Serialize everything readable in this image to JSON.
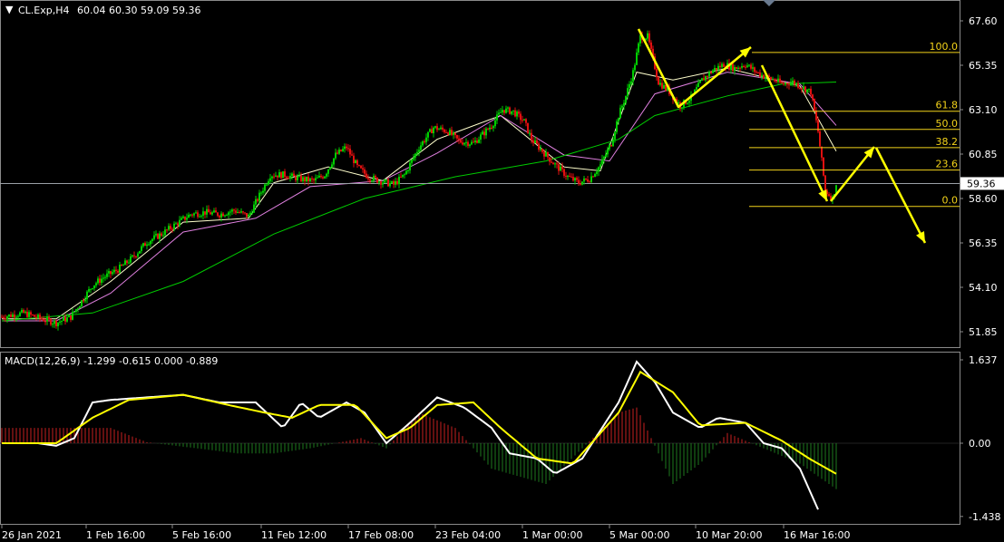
{
  "header": {
    "arrow": "▼",
    "symbol": "CL.Exp,H4",
    "ohlc": "60.04 60.30 59.09 59.36"
  },
  "price_axis": {
    "labels": [
      "67.60",
      "65.35",
      "63.10",
      "60.85",
      "58.60",
      "56.35",
      "54.10",
      "51.85"
    ],
    "current_price": "59.36"
  },
  "macd_header": {
    "label": "MACD(12,26,9) -1.299 -0.615 0.000 -0.889"
  },
  "macd_axis": {
    "labels": [
      "1.637",
      "0.00",
      "-1.438"
    ]
  },
  "time_axis": {
    "labels": [
      "26 Jan 2021",
      "1 Feb 16:00",
      "5 Feb 16:00",
      "11 Feb 12:00",
      "17 Feb 08:00",
      "23 Feb 04:00",
      "1 Mar 00:00",
      "5 Mar 00:00",
      "10 Mar 20:00",
      "16 Mar 16:00"
    ]
  },
  "fibonacci": {
    "levels": [
      "100.0",
      "61.8",
      "50.0",
      "38.2",
      "23.6",
      "0.0"
    ],
    "high": 66.0,
    "low": 58.2
  },
  "colors": {
    "background": "#000000",
    "bull": "#00cc00",
    "bear": "#e01010",
    "ma_fast": "#ffffcc",
    "ma_mid": "#e080e0",
    "ma_slow": "#00cc00",
    "fib": "#f2d21a",
    "arrow": "#ffff00",
    "macd_line": "#ffffff",
    "signal_line": "#ffff00",
    "hist_pos": "#c82020",
    "hist_neg": "#1e7a1e"
  },
  "chart_data": [
    {
      "type": "candlestick",
      "title": "CL.Exp,H4",
      "ylim": [
        51.85,
        67.6
      ],
      "x_ticks": [
        "26 Jan 2021",
        "1 Feb 16:00",
        "5 Feb 16:00",
        "11 Feb 12:00",
        "17 Feb 08:00",
        "23 Feb 04:00",
        "1 Mar 00:00",
        "5 Mar 00:00",
        "10 Mar 20:00",
        "16 Mar 16:00"
      ],
      "close_path": [
        [
          0,
          52.6
        ],
        [
          12,
          52.8
        ],
        [
          22,
          52.5
        ],
        [
          30,
          52.3
        ],
        [
          38,
          52.6
        ],
        [
          44,
          53.4
        ],
        [
          50,
          54.2
        ],
        [
          56,
          54.6
        ],
        [
          64,
          55.0
        ],
        [
          72,
          55.6
        ],
        [
          80,
          56.4
        ],
        [
          88,
          56.8
        ],
        [
          96,
          57.3
        ],
        [
          104,
          57.8
        ],
        [
          112,
          57.9
        ],
        [
          120,
          57.8
        ],
        [
          128,
          58.0
        ],
        [
          136,
          57.7
        ],
        [
          140,
          58.4
        ],
        [
          148,
          59.8
        ],
        [
          156,
          59.8
        ],
        [
          164,
          59.6
        ],
        [
          172,
          59.5
        ],
        [
          178,
          59.8
        ],
        [
          184,
          60.8
        ],
        [
          190,
          61.2
        ],
        [
          196,
          60.2
        ],
        [
          202,
          59.7
        ],
        [
          208,
          59.5
        ],
        [
          216,
          59.3
        ],
        [
          222,
          59.8
        ],
        [
          230,
          61.2
        ],
        [
          238,
          62.2
        ],
        [
          246,
          62.0
        ],
        [
          252,
          61.5
        ],
        [
          260,
          61.4
        ],
        [
          270,
          62.3
        ],
        [
          276,
          63.1
        ],
        [
          282,
          63.0
        ],
        [
          288,
          62.5
        ],
        [
          292,
          61.6
        ],
        [
          298,
          61.0
        ],
        [
          304,
          60.4
        ],
        [
          312,
          59.7
        ],
        [
          318,
          59.4
        ],
        [
          324,
          59.6
        ],
        [
          330,
          60.3
        ],
        [
          336,
          61.4
        ],
        [
          340,
          62.8
        ],
        [
          344,
          63.8
        ],
        [
          348,
          65.0
        ],
        [
          352,
          66.8
        ],
        [
          356,
          66.8
        ],
        [
          362,
          64.5
        ],
        [
          368,
          64.0
        ],
        [
          374,
          63.3
        ],
        [
          380,
          63.7
        ],
        [
          386,
          64.6
        ],
        [
          392,
          65.1
        ],
        [
          398,
          65.4
        ],
        [
          404,
          65.2
        ],
        [
          410,
          65.4
        ],
        [
          416,
          65.0
        ],
        [
          420,
          64.8
        ],
        [
          426,
          64.6
        ],
        [
          430,
          64.4
        ],
        [
          436,
          64.5
        ],
        [
          442,
          64.2
        ],
        [
          446,
          64.0
        ],
        [
          450,
          62.0
        ],
        [
          454,
          59.0
        ],
        [
          458,
          58.6
        ],
        [
          460,
          59.36
        ]
      ],
      "moving_averages": [
        {
          "name": "fast",
          "values": [
            [
              0,
              52.5
            ],
            [
              30,
              52.5
            ],
            [
              60,
              54.4
            ],
            [
              100,
              57.4
            ],
            [
              136,
              57.6
            ],
            [
              150,
              59.4
            ],
            [
              180,
              60.2
            ],
            [
              210,
              59.5
            ],
            [
              240,
              61.6
            ],
            [
              275,
              62.8
            ],
            [
              310,
              60.2
            ],
            [
              330,
              60.0
            ],
            [
              350,
              65.0
            ],
            [
              370,
              64.6
            ],
            [
              400,
              65.2
            ],
            [
              440,
              64.3
            ],
            [
              460,
              61.0
            ]
          ]
        },
        {
          "name": "mid",
          "values": [
            [
              0,
              52.4
            ],
            [
              30,
              52.4
            ],
            [
              60,
              53.8
            ],
            [
              100,
              56.9
            ],
            [
              140,
              57.6
            ],
            [
              170,
              59.2
            ],
            [
              210,
              59.5
            ],
            [
              240,
              60.9
            ],
            [
              275,
              62.8
            ],
            [
              310,
              60.8
            ],
            [
              335,
              60.5
            ],
            [
              360,
              63.9
            ],
            [
              400,
              65.0
            ],
            [
              440,
              64.4
            ],
            [
              460,
              62.3
            ]
          ]
        },
        {
          "name": "slow",
          "values": [
            [
              0,
              52.4
            ],
            [
              50,
              52.8
            ],
            [
              100,
              54.4
            ],
            [
              150,
              56.8
            ],
            [
              200,
              58.6
            ],
            [
              250,
              59.7
            ],
            [
              300,
              60.5
            ],
            [
              340,
              61.6
            ],
            [
              360,
              62.8
            ],
            [
              400,
              63.8
            ],
            [
              430,
              64.4
            ],
            [
              460,
              64.5
            ]
          ]
        }
      ],
      "fib_levels": {
        "100.0": 66.0,
        "61.8": 63.02,
        "50.0": 62.1,
        "38.2": 61.18,
        "23.6": 60.04,
        "0.0": 58.2
      },
      "current_price": 59.36
    },
    {
      "type": "line",
      "title": "MACD(12,26,9) -1.299 -0.615 0.000 -0.889",
      "ylim": [
        -1.438,
        1.637
      ],
      "series": [
        {
          "name": "MACD",
          "values": [
            [
              0,
              0.0
            ],
            [
              20,
              0.0
            ],
            [
              30,
              -0.05
            ],
            [
              40,
              0.1
            ],
            [
              50,
              0.8
            ],
            [
              60,
              0.85
            ],
            [
              80,
              0.9
            ],
            [
              100,
              0.95
            ],
            [
              120,
              0.8
            ],
            [
              140,
              0.8
            ],
            [
              155,
              0.3
            ],
            [
              165,
              0.8
            ],
            [
              175,
              0.5
            ],
            [
              190,
              0.8
            ],
            [
              200,
              0.6
            ],
            [
              212,
              0.0
            ],
            [
              225,
              0.4
            ],
            [
              240,
              0.9
            ],
            [
              255,
              0.7
            ],
            [
              270,
              0.3
            ],
            [
              280,
              -0.2
            ],
            [
              295,
              -0.3
            ],
            [
              305,
              -0.6
            ],
            [
              320,
              -0.3
            ],
            [
              340,
              0.8
            ],
            [
              350,
              1.6
            ],
            [
              360,
              1.2
            ],
            [
              370,
              0.6
            ],
            [
              385,
              0.3
            ],
            [
              395,
              0.5
            ],
            [
              410,
              0.4
            ],
            [
              420,
              0.0
            ],
            [
              430,
              -0.1
            ],
            [
              440,
              -0.5
            ],
            [
              450,
              -1.3
            ]
          ]
        },
        {
          "name": "Signal",
          "values": [
            [
              0,
              0.0
            ],
            [
              30,
              0.0
            ],
            [
              50,
              0.5
            ],
            [
              70,
              0.85
            ],
            [
              100,
              0.95
            ],
            [
              125,
              0.75
            ],
            [
              145,
              0.6
            ],
            [
              160,
              0.5
            ],
            [
              175,
              0.75
            ],
            [
              195,
              0.75
            ],
            [
              212,
              0.1
            ],
            [
              225,
              0.3
            ],
            [
              240,
              0.75
            ],
            [
              260,
              0.8
            ],
            [
              275,
              0.3
            ],
            [
              295,
              -0.3
            ],
            [
              315,
              -0.4
            ],
            [
              340,
              0.6
            ],
            [
              352,
              1.4
            ],
            [
              370,
              1.0
            ],
            [
              385,
              0.35
            ],
            [
              410,
              0.4
            ],
            [
              430,
              0.05
            ],
            [
              445,
              -0.3
            ],
            [
              460,
              -0.6
            ]
          ]
        },
        {
          "name": "Histogram",
          "values": [
            [
              50,
              0.3
            ],
            [
              60,
              0.3
            ],
            [
              80,
              0.02
            ],
            [
              130,
              -0.2
            ],
            [
              150,
              -0.2
            ],
            [
              170,
              -0.1
            ],
            [
              198,
              0.1
            ],
            [
              212,
              -0.1
            ],
            [
              230,
              0.6
            ],
            [
              250,
              0.3
            ],
            [
              270,
              -0.5
            ],
            [
              300,
              -0.8
            ],
            [
              340,
              0.6
            ],
            [
              350,
              0.7
            ],
            [
              370,
              -0.8
            ],
            [
              385,
              -0.4
            ],
            [
              400,
              0.2
            ],
            [
              420,
              -0.1
            ],
            [
              440,
              -0.4
            ],
            [
              460,
              -0.9
            ]
          ]
        }
      ]
    }
  ]
}
